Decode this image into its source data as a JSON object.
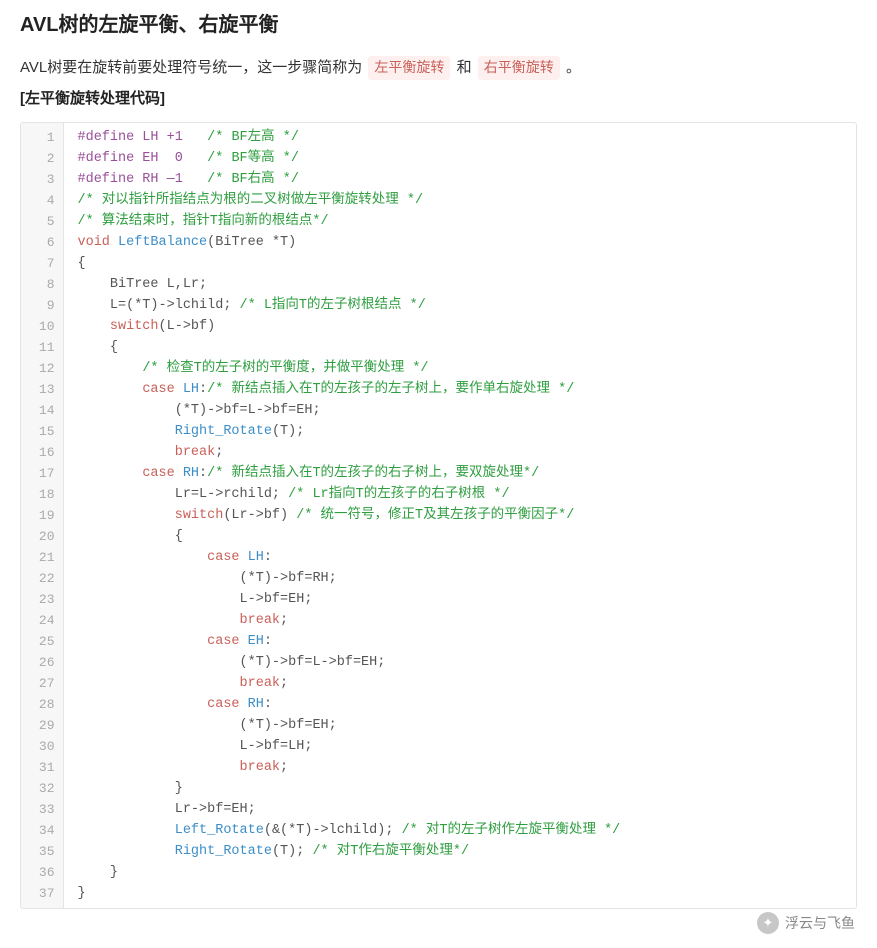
{
  "header": {
    "title": "AVL树的左旋平衡、右旋平衡"
  },
  "intro": {
    "prefix": "AVL树要在旋转前要处理符号统一，这一步骤简称为 ",
    "term1": "左平衡旋转",
    "mid": " 和 ",
    "term2": "右平衡旋转",
    "suffix": " 。"
  },
  "subtitle": "[左平衡旋转处理代码]",
  "code": [
    {
      "n": 1,
      "tokens": [
        {
          "c": "tok-pre",
          "t": "#define LH +1"
        },
        {
          "c": "",
          "t": "   "
        },
        {
          "c": "tok-com",
          "t": "/* BF左高 */"
        }
      ]
    },
    {
      "n": 2,
      "tokens": [
        {
          "c": "tok-pre",
          "t": "#define EH  0"
        },
        {
          "c": "",
          "t": "   "
        },
        {
          "c": "tok-com",
          "t": "/* BF等高 */"
        }
      ]
    },
    {
      "n": 3,
      "tokens": [
        {
          "c": "tok-pre",
          "t": "#define RH —1"
        },
        {
          "c": "",
          "t": "   "
        },
        {
          "c": "tok-com",
          "t": "/* BF右高 */"
        }
      ]
    },
    {
      "n": 4,
      "tokens": [
        {
          "c": "tok-com",
          "t": "/* 对以指针所指结点为根的二叉树做左平衡旋转处理 */"
        }
      ]
    },
    {
      "n": 5,
      "tokens": [
        {
          "c": "tok-com",
          "t": "/* 算法结束时，指针T指向新的根结点*/"
        }
      ]
    },
    {
      "n": 6,
      "tokens": [
        {
          "c": "tok-kw",
          "t": "void"
        },
        {
          "c": "",
          "t": " "
        },
        {
          "c": "tok-func",
          "t": "LeftBalance"
        },
        {
          "c": "tok-id",
          "t": "(BiTree *T)"
        }
      ]
    },
    {
      "n": 7,
      "tokens": [
        {
          "c": "tok-id",
          "t": "{"
        }
      ]
    },
    {
      "n": 8,
      "tokens": [
        {
          "c": "",
          "t": "    "
        },
        {
          "c": "tok-id",
          "t": "BiTree L,Lr;"
        }
      ]
    },
    {
      "n": 9,
      "tokens": [
        {
          "c": "",
          "t": "    "
        },
        {
          "c": "tok-id",
          "t": "L=(*T)->lchild; "
        },
        {
          "c": "tok-com",
          "t": "/* L指向T的左子树根结点 */"
        }
      ]
    },
    {
      "n": 10,
      "tokens": [
        {
          "c": "",
          "t": "    "
        },
        {
          "c": "tok-kw",
          "t": "switch"
        },
        {
          "c": "tok-id",
          "t": "(L->bf)"
        }
      ]
    },
    {
      "n": 11,
      "tokens": [
        {
          "c": "",
          "t": "    "
        },
        {
          "c": "tok-id",
          "t": "{"
        }
      ]
    },
    {
      "n": 12,
      "tokens": [
        {
          "c": "",
          "t": "        "
        },
        {
          "c": "tok-com",
          "t": "/* 检查T的左子树的平衡度，并做平衡处理 */"
        }
      ]
    },
    {
      "n": 13,
      "tokens": [
        {
          "c": "",
          "t": "        "
        },
        {
          "c": "tok-kw",
          "t": "case"
        },
        {
          "c": "",
          "t": " "
        },
        {
          "c": "tok-func",
          "t": "LH"
        },
        {
          "c": "tok-id",
          "t": ":"
        },
        {
          "c": "tok-com",
          "t": "/* 新结点插入在T的左孩子的左子树上，要作单右旋处理 */"
        }
      ]
    },
    {
      "n": 14,
      "tokens": [
        {
          "c": "",
          "t": "            "
        },
        {
          "c": "tok-id",
          "t": "(*T)->bf=L->bf=EH;"
        }
      ]
    },
    {
      "n": 15,
      "tokens": [
        {
          "c": "",
          "t": "            "
        },
        {
          "c": "tok-func",
          "t": "Right_Rotate"
        },
        {
          "c": "tok-id",
          "t": "(T);"
        }
      ]
    },
    {
      "n": 16,
      "tokens": [
        {
          "c": "",
          "t": "            "
        },
        {
          "c": "tok-kw",
          "t": "break"
        },
        {
          "c": "tok-id",
          "t": ";"
        }
      ]
    },
    {
      "n": 17,
      "tokens": [
        {
          "c": "",
          "t": "        "
        },
        {
          "c": "tok-kw",
          "t": "case"
        },
        {
          "c": "",
          "t": " "
        },
        {
          "c": "tok-func",
          "t": "RH"
        },
        {
          "c": "tok-id",
          "t": ":"
        },
        {
          "c": "tok-com",
          "t": "/* 新结点插入在T的左孩子的右子树上，要双旋处理*/"
        }
      ]
    },
    {
      "n": 18,
      "tokens": [
        {
          "c": "",
          "t": "            "
        },
        {
          "c": "tok-id",
          "t": "Lr=L->rchild; "
        },
        {
          "c": "tok-com",
          "t": "/* Lr指向T的左孩子的右子树根 */"
        }
      ]
    },
    {
      "n": 19,
      "tokens": [
        {
          "c": "",
          "t": "            "
        },
        {
          "c": "tok-kw",
          "t": "switch"
        },
        {
          "c": "tok-id",
          "t": "(Lr->bf) "
        },
        {
          "c": "tok-com",
          "t": "/* 统一符号，修正T及其左孩子的平衡因子*/"
        }
      ]
    },
    {
      "n": 20,
      "tokens": [
        {
          "c": "",
          "t": "            "
        },
        {
          "c": "tok-id",
          "t": "{"
        }
      ]
    },
    {
      "n": 21,
      "tokens": [
        {
          "c": "",
          "t": "                "
        },
        {
          "c": "tok-kw",
          "t": "case"
        },
        {
          "c": "",
          "t": " "
        },
        {
          "c": "tok-func",
          "t": "LH"
        },
        {
          "c": "tok-id",
          "t": ":"
        }
      ]
    },
    {
      "n": 22,
      "tokens": [
        {
          "c": "",
          "t": "                    "
        },
        {
          "c": "tok-id",
          "t": "(*T)->bf=RH;"
        }
      ]
    },
    {
      "n": 23,
      "tokens": [
        {
          "c": "",
          "t": "                    "
        },
        {
          "c": "tok-id",
          "t": "L->bf=EH;"
        }
      ]
    },
    {
      "n": 24,
      "tokens": [
        {
          "c": "",
          "t": "                    "
        },
        {
          "c": "tok-kw",
          "t": "break"
        },
        {
          "c": "tok-id",
          "t": ";"
        }
      ]
    },
    {
      "n": 25,
      "tokens": [
        {
          "c": "",
          "t": "                "
        },
        {
          "c": "tok-kw",
          "t": "case"
        },
        {
          "c": "",
          "t": " "
        },
        {
          "c": "tok-func",
          "t": "EH"
        },
        {
          "c": "tok-id",
          "t": ":"
        }
      ]
    },
    {
      "n": 26,
      "tokens": [
        {
          "c": "",
          "t": "                    "
        },
        {
          "c": "tok-id",
          "t": "(*T)->bf=L->bf=EH;"
        }
      ]
    },
    {
      "n": 27,
      "tokens": [
        {
          "c": "",
          "t": "                    "
        },
        {
          "c": "tok-kw",
          "t": "break"
        },
        {
          "c": "tok-id",
          "t": ";"
        }
      ]
    },
    {
      "n": 28,
      "tokens": [
        {
          "c": "",
          "t": "                "
        },
        {
          "c": "tok-kw",
          "t": "case"
        },
        {
          "c": "",
          "t": " "
        },
        {
          "c": "tok-func",
          "t": "RH"
        },
        {
          "c": "tok-id",
          "t": ":"
        }
      ]
    },
    {
      "n": 29,
      "tokens": [
        {
          "c": "",
          "t": "                    "
        },
        {
          "c": "tok-id",
          "t": "(*T)->bf=EH;"
        }
      ]
    },
    {
      "n": 30,
      "tokens": [
        {
          "c": "",
          "t": "                    "
        },
        {
          "c": "tok-id",
          "t": "L->bf=LH;"
        }
      ]
    },
    {
      "n": 31,
      "tokens": [
        {
          "c": "",
          "t": "                    "
        },
        {
          "c": "tok-kw",
          "t": "break"
        },
        {
          "c": "tok-id",
          "t": ";"
        }
      ]
    },
    {
      "n": 32,
      "tokens": [
        {
          "c": "",
          "t": "            "
        },
        {
          "c": "tok-id",
          "t": "}"
        }
      ]
    },
    {
      "n": 33,
      "tokens": [
        {
          "c": "",
          "t": "            "
        },
        {
          "c": "tok-id",
          "t": "Lr->bf=EH;"
        }
      ]
    },
    {
      "n": 34,
      "tokens": [
        {
          "c": "",
          "t": "            "
        },
        {
          "c": "tok-func",
          "t": "Left_Rotate"
        },
        {
          "c": "tok-id",
          "t": "(&(*T)->lchild); "
        },
        {
          "c": "tok-com",
          "t": "/* 对T的左子树作左旋平衡处理 */"
        }
      ]
    },
    {
      "n": 35,
      "tokens": [
        {
          "c": "",
          "t": "            "
        },
        {
          "c": "tok-func",
          "t": "Right_Rotate"
        },
        {
          "c": "tok-id",
          "t": "(T); "
        },
        {
          "c": "tok-com",
          "t": "/* 对T作右旋平衡处理*/"
        }
      ]
    },
    {
      "n": 36,
      "tokens": [
        {
          "c": "",
          "t": "    "
        },
        {
          "c": "tok-id",
          "t": "}"
        }
      ]
    },
    {
      "n": 37,
      "tokens": [
        {
          "c": "tok-id",
          "t": "}"
        }
      ]
    }
  ],
  "footer": {
    "logo_glyph": "✦",
    "text": "浮云与飞鱼"
  }
}
